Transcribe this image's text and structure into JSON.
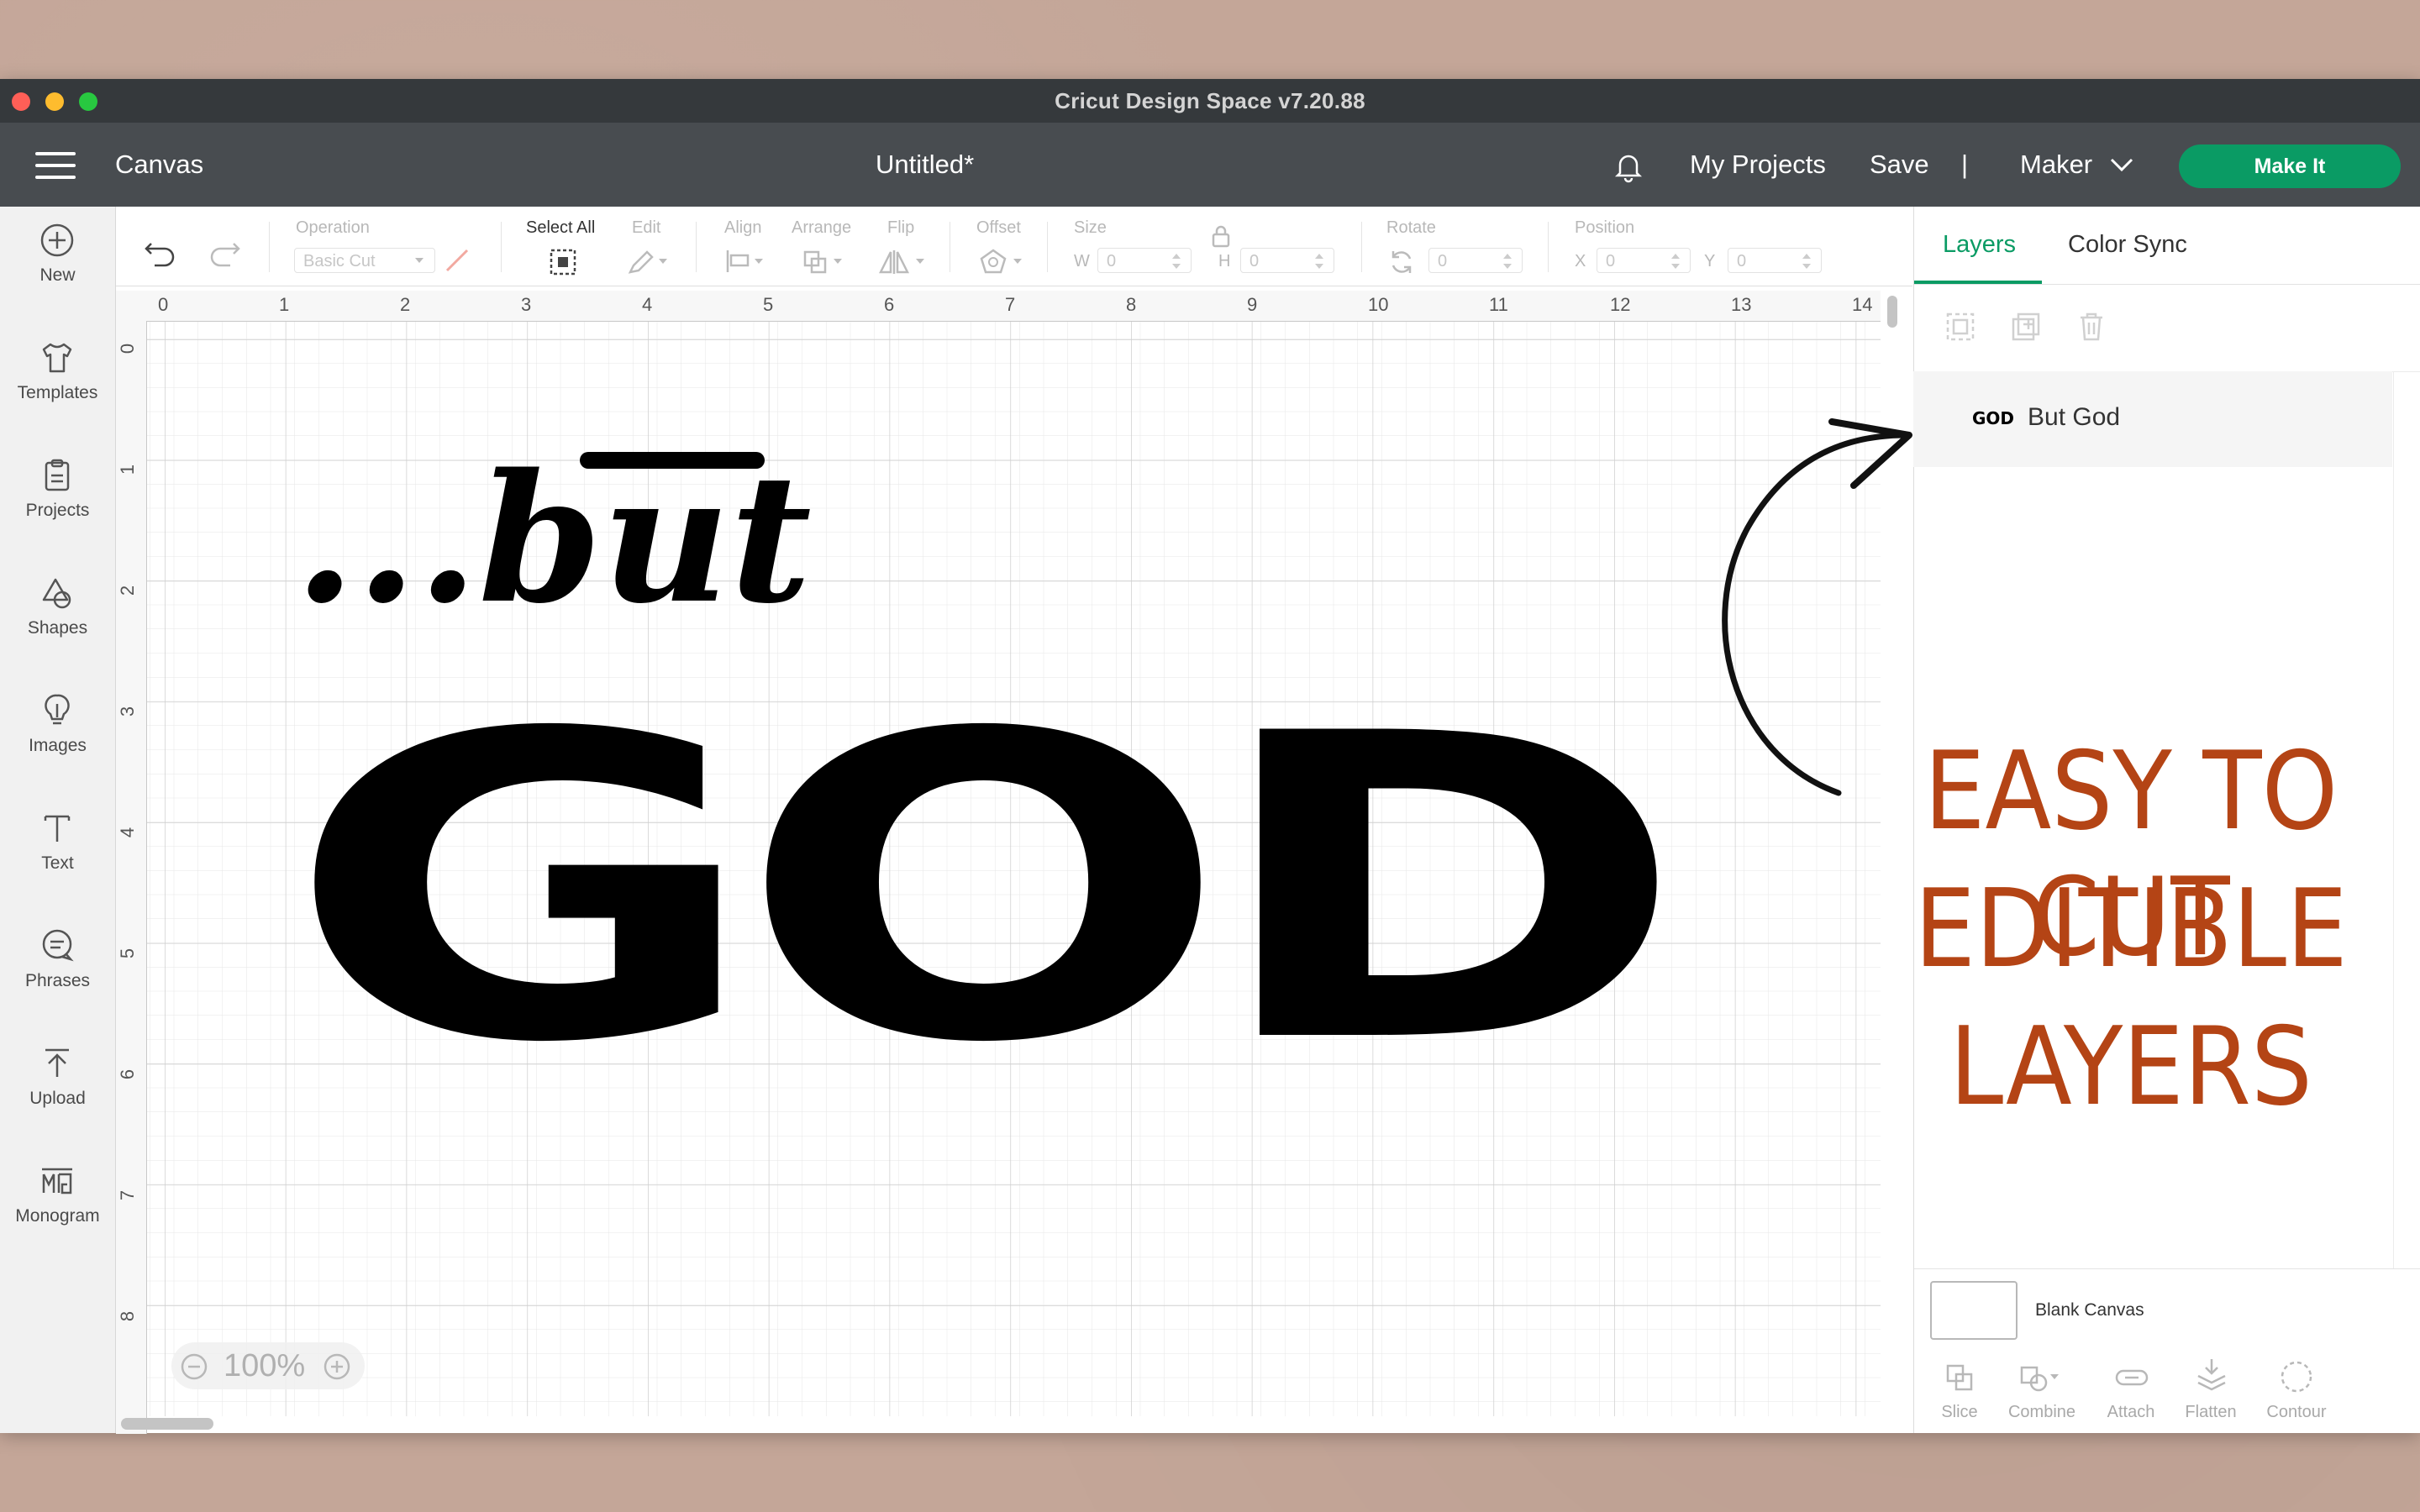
{
  "window": {
    "title": "Cricut Design Space  v7.20.88"
  },
  "appbar": {
    "menu_label": "Canvas",
    "document_title": "Untitled*",
    "my_projects": "My Projects",
    "save": "Save",
    "divider": "|",
    "machine": "Maker",
    "make_it": "Make It"
  },
  "sidebar": {
    "items": [
      {
        "label": "New",
        "icon": "plus-circle-icon"
      },
      {
        "label": "Templates",
        "icon": "tshirt-icon"
      },
      {
        "label": "Projects",
        "icon": "clipboard-icon"
      },
      {
        "label": "Shapes",
        "icon": "shapes-icon"
      },
      {
        "label": "Images",
        "icon": "lightbulb-icon"
      },
      {
        "label": "Text",
        "icon": "text-icon"
      },
      {
        "label": "Phrases",
        "icon": "speech-bubble-icon"
      },
      {
        "label": "Upload",
        "icon": "upload-icon"
      },
      {
        "label": "Monogram",
        "icon": "monogram-icon"
      }
    ]
  },
  "toolbar": {
    "operation_label": "Operation",
    "operation_value": "Basic Cut",
    "select_all": "Select All",
    "edit": "Edit",
    "align": "Align",
    "arrange": "Arrange",
    "flip": "Flip",
    "offset": "Offset",
    "size": "Size",
    "w_label": "W",
    "w_value": "0",
    "h_label": "H",
    "h_value": "0",
    "rotate": "Rotate",
    "rotate_value": "0",
    "position": "Position",
    "x_label": "X",
    "x_value": "0",
    "y_label": "Y",
    "y_value": "0"
  },
  "rulers": {
    "horizontal": [
      "0",
      "1",
      "2",
      "3",
      "4",
      "5",
      "6",
      "7",
      "8",
      "9",
      "10",
      "11",
      "12",
      "13",
      "14"
    ],
    "vertical": [
      "0",
      "1",
      "2",
      "3",
      "4",
      "5",
      "6",
      "7",
      "8"
    ]
  },
  "canvas": {
    "design_script": "...but",
    "design_word": "GOD",
    "zoom": "100%"
  },
  "panel": {
    "tabs": [
      "Layers",
      "Color Sync"
    ],
    "active_tab": "Layers",
    "layer_thumb": "GOD",
    "layer_name": "But God",
    "blank_canvas": "Blank Canvas",
    "bottom_tools": [
      "Slice",
      "Combine",
      "Attach",
      "Flatten",
      "Contour"
    ]
  },
  "overlay": {
    "line1": "EASY TO CUT",
    "line2": "EDITIBLE",
    "line3": "LAYERS",
    "color": "#b44415"
  },
  "colors": {
    "accent": "#0a9b64",
    "appbar": "#484c50",
    "titlebar": "#35393c"
  }
}
